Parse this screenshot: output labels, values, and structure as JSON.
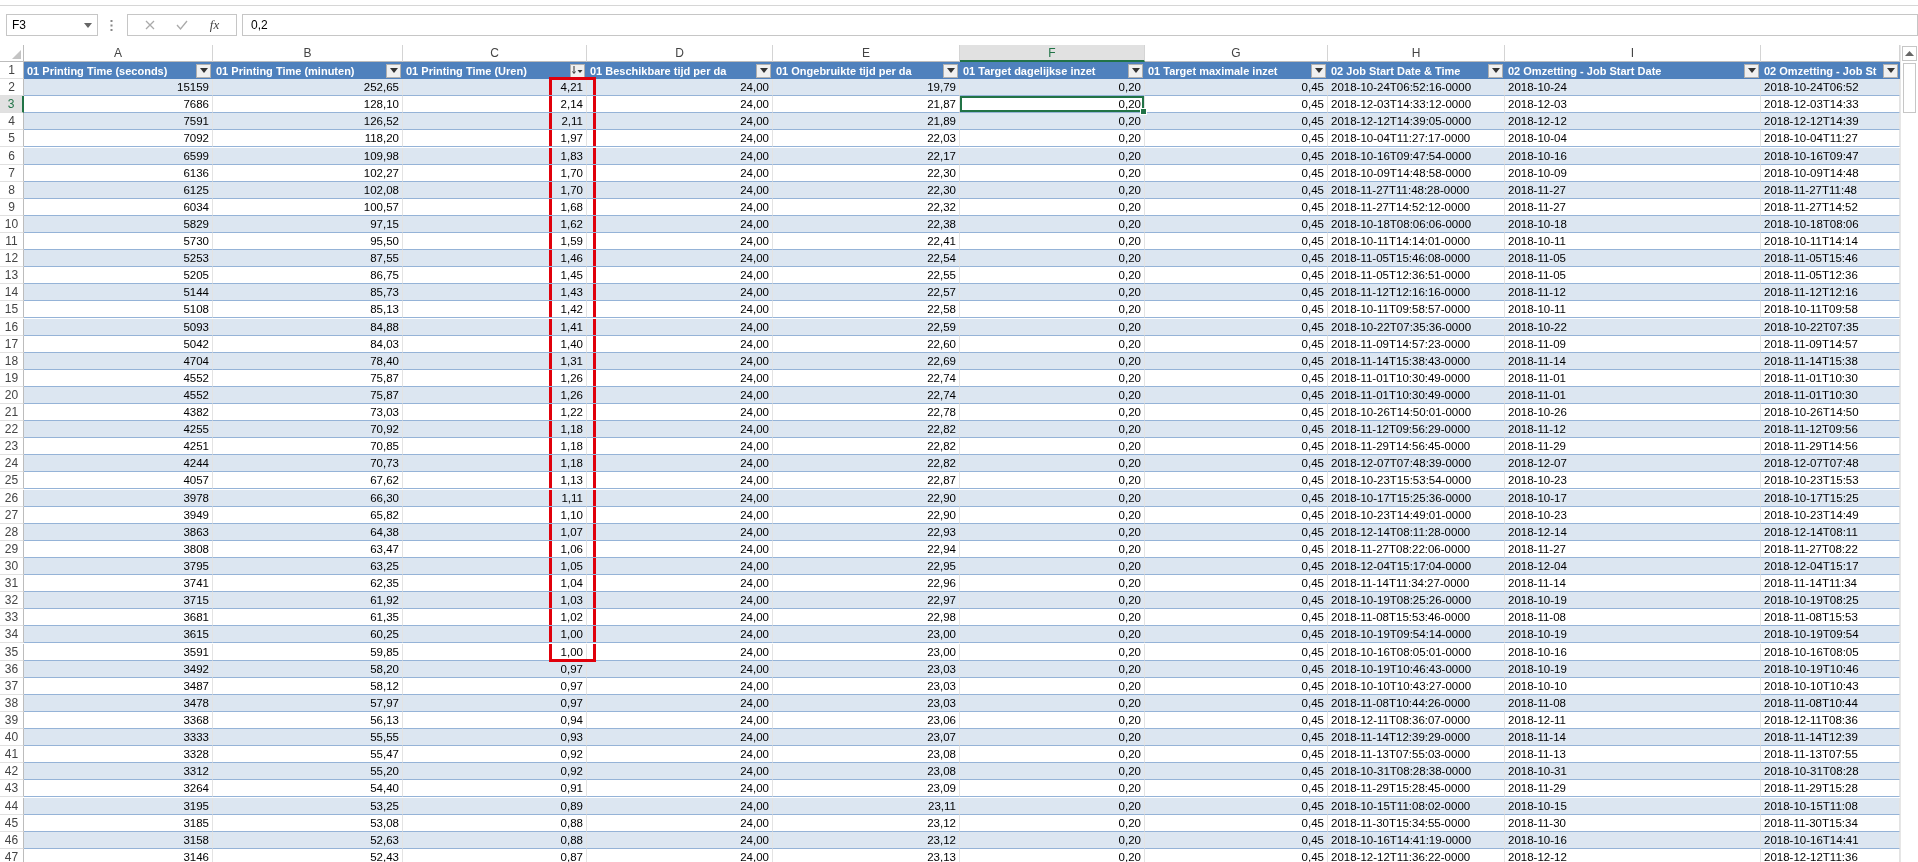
{
  "formula_bar": {
    "name_box": "F3",
    "function_label": "fx",
    "formula": "0,2"
  },
  "table": {
    "header_row_number": "1",
    "columns": [
      {
        "letter": "A",
        "header": "01 Printing Time (seconds)",
        "kind": "number",
        "sorted": false,
        "selected": false
      },
      {
        "letter": "B",
        "header": "01 Printing Time (minuten)",
        "kind": "number",
        "sorted": false,
        "selected": false
      },
      {
        "letter": "C",
        "header": "01 Printing Time (Uren)",
        "kind": "number",
        "sorted": true,
        "selected": false
      },
      {
        "letter": "D",
        "header": "01 Beschikbare tijd per da",
        "kind": "number",
        "sorted": false,
        "selected": false
      },
      {
        "letter": "E",
        "header": "01 Ongebruikte tijd per da",
        "kind": "number",
        "sorted": false,
        "selected": false
      },
      {
        "letter": "F",
        "header": "01 Target dagelijkse inzet",
        "kind": "number",
        "sorted": false,
        "selected": true
      },
      {
        "letter": "G",
        "header": "01 Target maximale inzet",
        "kind": "number",
        "sorted": false,
        "selected": false
      },
      {
        "letter": "H",
        "header": "02 Job Start Date & Time",
        "kind": "text",
        "sorted": false,
        "selected": false
      },
      {
        "letter": "I",
        "header": "02 Omzetting - Job Start Date",
        "kind": "text",
        "sorted": false,
        "selected": false
      },
      {
        "header": "02 Omzetting - Job St",
        "kind": "text",
        "sorted": false,
        "selected": false
      }
    ],
    "rows": [
      {
        "num": "2",
        "marked": true,
        "selected": false,
        "cells": [
          "15159",
          "252,65",
          "4,21",
          "24,00",
          "19,79",
          "0,20",
          "0,45",
          "2018-10-24T06:52:16-0000",
          "2018-10-24",
          "2018-10-24T06:52"
        ]
      },
      {
        "num": "3",
        "marked": true,
        "selected": true,
        "cells": [
          "7686",
          "128,10",
          "2,14",
          "24,00",
          "21,87",
          "0,20",
          "0,45",
          "2018-12-03T14:33:12-0000",
          "2018-12-03",
          "2018-12-03T14:33"
        ]
      },
      {
        "num": "4",
        "marked": true,
        "selected": false,
        "cells": [
          "7591",
          "126,52",
          "2,11",
          "24,00",
          "21,89",
          "0,20",
          "0,45",
          "2018-12-12T14:39:05-0000",
          "2018-12-12",
          "2018-12-12T14:39"
        ]
      },
      {
        "num": "5",
        "marked": true,
        "selected": false,
        "cells": [
          "7092",
          "118,20",
          "1,97",
          "24,00",
          "22,03",
          "0,20",
          "0,45",
          "2018-10-04T11:27:17-0000",
          "2018-10-04",
          "2018-10-04T11:27"
        ]
      },
      {
        "num": "6",
        "marked": true,
        "selected": false,
        "cells": [
          "6599",
          "109,98",
          "1,83",
          "24,00",
          "22,17",
          "0,20",
          "0,45",
          "2018-10-16T09:47:54-0000",
          "2018-10-16",
          "2018-10-16T09:47"
        ]
      },
      {
        "num": "7",
        "marked": true,
        "selected": false,
        "cells": [
          "6136",
          "102,27",
          "1,70",
          "24,00",
          "22,30",
          "0,20",
          "0,45",
          "2018-10-09T14:48:58-0000",
          "2018-10-09",
          "2018-10-09T14:48"
        ]
      },
      {
        "num": "8",
        "marked": true,
        "selected": false,
        "cells": [
          "6125",
          "102,08",
          "1,70",
          "24,00",
          "22,30",
          "0,20",
          "0,45",
          "2018-11-27T11:48:28-0000",
          "2018-11-27",
          "2018-11-27T11:48"
        ]
      },
      {
        "num": "9",
        "marked": true,
        "selected": false,
        "cells": [
          "6034",
          "100,57",
          "1,68",
          "24,00",
          "22,32",
          "0,20",
          "0,45",
          "2018-11-27T14:52:12-0000",
          "2018-11-27",
          "2018-11-27T14:52"
        ]
      },
      {
        "num": "10",
        "marked": true,
        "selected": false,
        "cells": [
          "5829",
          "97,15",
          "1,62",
          "24,00",
          "22,38",
          "0,20",
          "0,45",
          "2018-10-18T08:06:06-0000",
          "2018-10-18",
          "2018-10-18T08:06"
        ]
      },
      {
        "num": "11",
        "marked": true,
        "selected": false,
        "cells": [
          "5730",
          "95,50",
          "1,59",
          "24,00",
          "22,41",
          "0,20",
          "0,45",
          "2018-10-11T14:14:01-0000",
          "2018-10-11",
          "2018-10-11T14:14"
        ]
      },
      {
        "num": "12",
        "marked": true,
        "selected": false,
        "cells": [
          "5253",
          "87,55",
          "1,46",
          "24,00",
          "22,54",
          "0,20",
          "0,45",
          "2018-11-05T15:46:08-0000",
          "2018-11-05",
          "2018-11-05T15:46"
        ]
      },
      {
        "num": "13",
        "marked": true,
        "selected": false,
        "cells": [
          "5205",
          "86,75",
          "1,45",
          "24,00",
          "22,55",
          "0,20",
          "0,45",
          "2018-11-05T12:36:51-0000",
          "2018-11-05",
          "2018-11-05T12:36"
        ]
      },
      {
        "num": "14",
        "marked": true,
        "selected": false,
        "cells": [
          "5144",
          "85,73",
          "1,43",
          "24,00",
          "22,57",
          "0,20",
          "0,45",
          "2018-11-12T12:16:16-0000",
          "2018-11-12",
          "2018-11-12T12:16"
        ]
      },
      {
        "num": "15",
        "marked": true,
        "selected": false,
        "cells": [
          "5108",
          "85,13",
          "1,42",
          "24,00",
          "22,58",
          "0,20",
          "0,45",
          "2018-10-11T09:58:57-0000",
          "2018-10-11",
          "2018-10-11T09:58"
        ]
      },
      {
        "num": "16",
        "marked": true,
        "selected": false,
        "cells": [
          "5093",
          "84,88",
          "1,41",
          "24,00",
          "22,59",
          "0,20",
          "0,45",
          "2018-10-22T07:35:36-0000",
          "2018-10-22",
          "2018-10-22T07:35"
        ]
      },
      {
        "num": "17",
        "marked": true,
        "selected": false,
        "cells": [
          "5042",
          "84,03",
          "1,40",
          "24,00",
          "22,60",
          "0,20",
          "0,45",
          "2018-11-09T14:57:23-0000",
          "2018-11-09",
          "2018-11-09T14:57"
        ]
      },
      {
        "num": "18",
        "marked": true,
        "selected": false,
        "cells": [
          "4704",
          "78,40",
          "1,31",
          "24,00",
          "22,69",
          "0,20",
          "0,45",
          "2018-11-14T15:38:43-0000",
          "2018-11-14",
          "2018-11-14T15:38"
        ]
      },
      {
        "num": "19",
        "marked": true,
        "selected": false,
        "cells": [
          "4552",
          "75,87",
          "1,26",
          "24,00",
          "22,74",
          "0,20",
          "0,45",
          "2018-11-01T10:30:49-0000",
          "2018-11-01",
          "2018-11-01T10:30"
        ]
      },
      {
        "num": "20",
        "marked": true,
        "selected": false,
        "cells": [
          "4552",
          "75,87",
          "1,26",
          "24,00",
          "22,74",
          "0,20",
          "0,45",
          "2018-11-01T10:30:49-0000",
          "2018-11-01",
          "2018-11-01T10:30"
        ]
      },
      {
        "num": "21",
        "marked": true,
        "selected": false,
        "cells": [
          "4382",
          "73,03",
          "1,22",
          "24,00",
          "22,78",
          "0,20",
          "0,45",
          "2018-10-26T14:50:01-0000",
          "2018-10-26",
          "2018-10-26T14:50"
        ]
      },
      {
        "num": "22",
        "marked": true,
        "selected": false,
        "cells": [
          "4255",
          "70,92",
          "1,18",
          "24,00",
          "22,82",
          "0,20",
          "0,45",
          "2018-11-12T09:56:29-0000",
          "2018-11-12",
          "2018-11-12T09:56"
        ]
      },
      {
        "num": "23",
        "marked": true,
        "selected": false,
        "cells": [
          "4251",
          "70,85",
          "1,18",
          "24,00",
          "22,82",
          "0,20",
          "0,45",
          "2018-11-29T14:56:45-0000",
          "2018-11-29",
          "2018-11-29T14:56"
        ]
      },
      {
        "num": "24",
        "marked": true,
        "selected": false,
        "cells": [
          "4244",
          "70,73",
          "1,18",
          "24,00",
          "22,82",
          "0,20",
          "0,45",
          "2018-12-07T07:48:39-0000",
          "2018-12-07",
          "2018-12-07T07:48"
        ]
      },
      {
        "num": "25",
        "marked": true,
        "selected": false,
        "cells": [
          "4057",
          "67,62",
          "1,13",
          "24,00",
          "22,87",
          "0,20",
          "0,45",
          "2018-10-23T15:53:54-0000",
          "2018-10-23",
          "2018-10-23T15:53"
        ]
      },
      {
        "num": "26",
        "marked": true,
        "selected": false,
        "cells": [
          "3978",
          "66,30",
          "1,11",
          "24,00",
          "22,90",
          "0,20",
          "0,45",
          "2018-10-17T15:25:36-0000",
          "2018-10-17",
          "2018-10-17T15:25"
        ]
      },
      {
        "num": "27",
        "marked": true,
        "selected": false,
        "cells": [
          "3949",
          "65,82",
          "1,10",
          "24,00",
          "22,90",
          "0,20",
          "0,45",
          "2018-10-23T14:49:01-0000",
          "2018-10-23",
          "2018-10-23T14:49"
        ]
      },
      {
        "num": "28",
        "marked": true,
        "selected": false,
        "cells": [
          "3863",
          "64,38",
          "1,07",
          "24,00",
          "22,93",
          "0,20",
          "0,45",
          "2018-12-14T08:11:28-0000",
          "2018-12-14",
          "2018-12-14T08:11"
        ]
      },
      {
        "num": "29",
        "marked": true,
        "selected": false,
        "cells": [
          "3808",
          "63,47",
          "1,06",
          "24,00",
          "22,94",
          "0,20",
          "0,45",
          "2018-11-27T08:22:06-0000",
          "2018-11-27",
          "2018-11-27T08:22"
        ]
      },
      {
        "num": "30",
        "marked": true,
        "selected": false,
        "cells": [
          "3795",
          "63,25",
          "1,05",
          "24,00",
          "22,95",
          "0,20",
          "0,45",
          "2018-12-04T15:17:04-0000",
          "2018-12-04",
          "2018-12-04T15:17"
        ]
      },
      {
        "num": "31",
        "marked": true,
        "selected": false,
        "cells": [
          "3741",
          "62,35",
          "1,04",
          "24,00",
          "22,96",
          "0,20",
          "0,45",
          "2018-11-14T11:34:27-0000",
          "2018-11-14",
          "2018-11-14T11:34"
        ]
      },
      {
        "num": "32",
        "marked": true,
        "selected": false,
        "cells": [
          "3715",
          "61,92",
          "1,03",
          "24,00",
          "22,97",
          "0,20",
          "0,45",
          "2018-10-19T08:25:26-0000",
          "2018-10-19",
          "2018-10-19T08:25"
        ]
      },
      {
        "num": "33",
        "marked": true,
        "selected": false,
        "cells": [
          "3681",
          "61,35",
          "1,02",
          "24,00",
          "22,98",
          "0,20",
          "0,45",
          "2018-11-08T15:53:46-0000",
          "2018-11-08",
          "2018-11-08T15:53"
        ]
      },
      {
        "num": "34",
        "marked": true,
        "selected": false,
        "cells": [
          "3615",
          "60,25",
          "1,00",
          "24,00",
          "23,00",
          "0,20",
          "0,45",
          "2018-10-19T09:54:14-0000",
          "2018-10-19",
          "2018-10-19T09:54"
        ]
      },
      {
        "num": "35",
        "marked": true,
        "selected": false,
        "cells": [
          "3591",
          "59,85",
          "1,00",
          "24,00",
          "23,00",
          "0,20",
          "0,45",
          "2018-10-16T08:05:01-0000",
          "2018-10-16",
          "2018-10-16T08:05"
        ]
      },
      {
        "num": "36",
        "marked": false,
        "selected": false,
        "cells": [
          "3492",
          "58,20",
          "0,97",
          "24,00",
          "23,03",
          "0,20",
          "0,45",
          "2018-10-19T10:46:43-0000",
          "2018-10-19",
          "2018-10-19T10:46"
        ]
      },
      {
        "num": "37",
        "marked": false,
        "selected": false,
        "cells": [
          "3487",
          "58,12",
          "0,97",
          "24,00",
          "23,03",
          "0,20",
          "0,45",
          "2018-10-10T10:43:27-0000",
          "2018-10-10",
          "2018-10-10T10:43"
        ]
      },
      {
        "num": "38",
        "marked": false,
        "selected": false,
        "cells": [
          "3478",
          "57,97",
          "0,97",
          "24,00",
          "23,03",
          "0,20",
          "0,45",
          "2018-11-08T10:44:26-0000",
          "2018-11-08",
          "2018-11-08T10:44"
        ]
      },
      {
        "num": "39",
        "marked": false,
        "selected": false,
        "cells": [
          "3368",
          "56,13",
          "0,94",
          "24,00",
          "23,06",
          "0,20",
          "0,45",
          "2018-12-11T08:36:07-0000",
          "2018-12-11",
          "2018-12-11T08:36"
        ]
      },
      {
        "num": "40",
        "marked": false,
        "selected": false,
        "cells": [
          "3333",
          "55,55",
          "0,93",
          "24,00",
          "23,07",
          "0,20",
          "0,45",
          "2018-11-14T12:39:29-0000",
          "2018-11-14",
          "2018-11-14T12:39"
        ]
      },
      {
        "num": "41",
        "marked": false,
        "selected": false,
        "cells": [
          "3328",
          "55,47",
          "0,92",
          "24,00",
          "23,08",
          "0,20",
          "0,45",
          "2018-11-13T07:55:03-0000",
          "2018-11-13",
          "2018-11-13T07:55"
        ]
      },
      {
        "num": "42",
        "marked": false,
        "selected": false,
        "cells": [
          "3312",
          "55,20",
          "0,92",
          "24,00",
          "23,08",
          "0,20",
          "0,45",
          "2018-10-31T08:28:38-0000",
          "2018-10-31",
          "2018-10-31T08:28"
        ]
      },
      {
        "num": "43",
        "marked": false,
        "selected": false,
        "cells": [
          "3264",
          "54,40",
          "0,91",
          "24,00",
          "23,09",
          "0,20",
          "0,45",
          "2018-11-29T15:28:45-0000",
          "2018-11-29",
          "2018-11-29T15:28"
        ]
      },
      {
        "num": "44",
        "marked": false,
        "selected": false,
        "cells": [
          "3195",
          "53,25",
          "0,89",
          "24,00",
          "23,11",
          "0,20",
          "0,45",
          "2018-10-15T11:08:02-0000",
          "2018-10-15",
          "2018-10-15T11:08"
        ]
      },
      {
        "num": "45",
        "marked": false,
        "selected": false,
        "cells": [
          "3185",
          "53,08",
          "0,88",
          "24,00",
          "23,12",
          "0,20",
          "0,45",
          "2018-11-30T15:34:55-0000",
          "2018-11-30",
          "2018-11-30T15:34"
        ]
      },
      {
        "num": "46",
        "marked": false,
        "selected": false,
        "cells": [
          "3158",
          "52,63",
          "0,88",
          "24,00",
          "23,12",
          "0,20",
          "0,45",
          "2018-10-16T14:41:19-0000",
          "2018-10-16",
          "2018-10-16T14:41"
        ]
      },
      {
        "num": "47",
        "marked": false,
        "selected": false,
        "cells": [
          "3146",
          "52,43",
          "0,87",
          "24,00",
          "23,13",
          "0,20",
          "0,45",
          "2018-12-12T11:36:22-0000",
          "2018-12-12",
          "2018-12-12T11:36"
        ]
      }
    ]
  }
}
